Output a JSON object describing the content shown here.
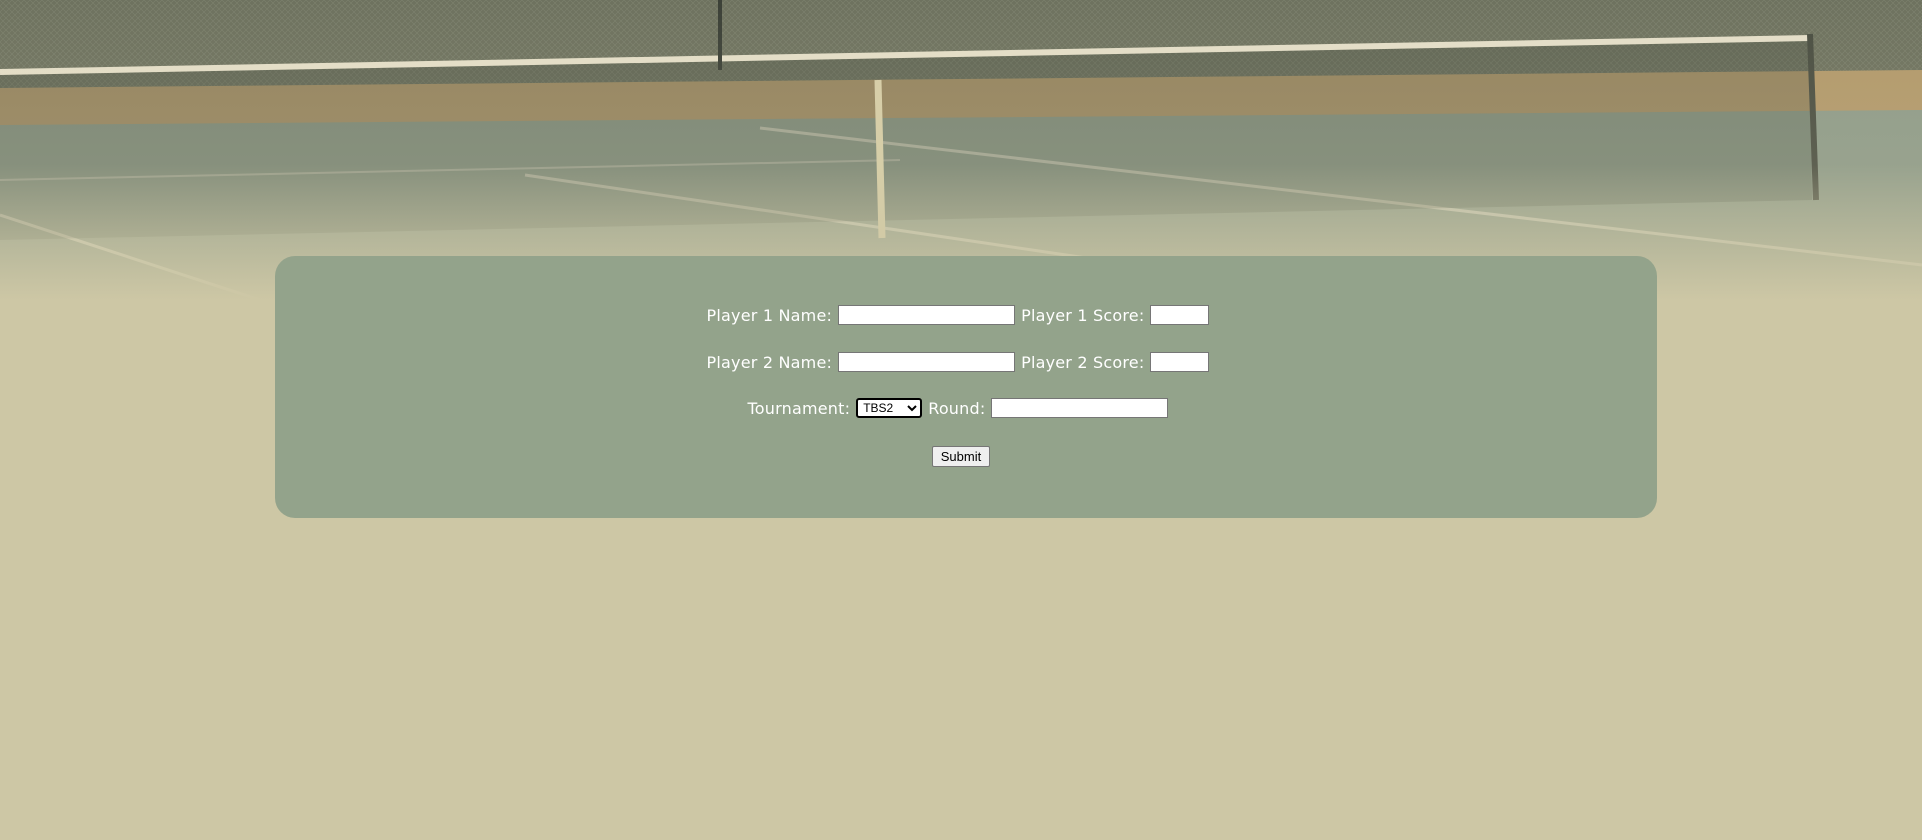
{
  "form": {
    "player1_name_label": "Player 1 Name:",
    "player1_name_value": "",
    "player1_score_label": "Player 1 Score:",
    "player1_score_value": "",
    "player2_name_label": "Player 2 Name:",
    "player2_name_value": "",
    "player2_score_label": "Player 2 Score:",
    "player2_score_value": "",
    "tournament_label": "Tournament:",
    "tournament_selected": "TBS2",
    "round_label": "Round:",
    "round_value": "",
    "submit_label": "Submit"
  },
  "colors": {
    "page_background": "#cdc7a5",
    "panel_background": "#93a38b",
    "label_text": "#ffffff"
  }
}
